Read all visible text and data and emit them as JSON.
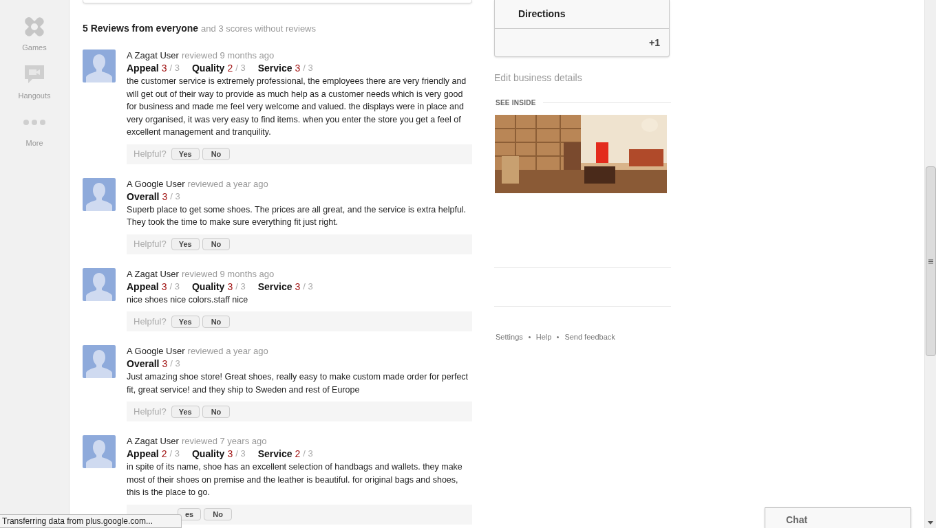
{
  "sidebar": {
    "items": [
      {
        "kind": "games",
        "label": "Games"
      },
      {
        "kind": "hangouts",
        "label": "Hangouts"
      },
      {
        "kind": "more",
        "label": "More"
      }
    ]
  },
  "reviews_header": {
    "title": "5 Reviews from everyone",
    "subtitle": "and 3 scores without reviews"
  },
  "reviews": [
    {
      "author": "A Zagat User",
      "when": "reviewed 9 months ago",
      "ratings": [
        {
          "label": "Appeal",
          "score": "3",
          "max": "/ 3"
        },
        {
          "label": "Quality",
          "score": "2",
          "max": "/ 3"
        },
        {
          "label": "Service",
          "score": "3",
          "max": "/ 3"
        }
      ],
      "text": "the customer service is extremely professional, the employees there are very friendly and will get out of their way to provide as much help as a customer needs which is very good for business and made me feel very welcome and valued. the displays were in place and very organised, it was very easy to find items. when you enter the store you get a feel of excellent management and tranquility.",
      "helpful": {
        "label": "Helpful?",
        "yes": "Yes",
        "no": "No"
      }
    },
    {
      "author": "A Google User",
      "when": "reviewed a year ago",
      "ratings": [
        {
          "label": "Overall",
          "score": "3",
          "max": "/ 3"
        }
      ],
      "text": "Superb place to get some shoes. The prices are all great, and the service is extra helpful. They took the time to make sure everything fit just right.",
      "helpful": {
        "label": "Helpful?",
        "yes": "Yes",
        "no": "No"
      }
    },
    {
      "author": "A Zagat User",
      "when": "reviewed 9 months ago",
      "ratings": [
        {
          "label": "Appeal",
          "score": "3",
          "max": "/ 3"
        },
        {
          "label": "Quality",
          "score": "3",
          "max": "/ 3"
        },
        {
          "label": "Service",
          "score": "3",
          "max": "/ 3"
        }
      ],
      "text": "nice shoes nice colors.staff nice",
      "helpful": {
        "label": "Helpful?",
        "yes": "Yes",
        "no": "No"
      }
    },
    {
      "author": "A Google User",
      "when": "reviewed a year ago",
      "ratings": [
        {
          "label": "Overall",
          "score": "3",
          "max": "/ 3"
        }
      ],
      "text": "Just amazing shoe store! Great shoes, really easy to make custom made order for perfect fit, great service! and they ship to Sweden and rest of Europe",
      "helpful": {
        "label": "Helpful?",
        "yes": "Yes",
        "no": "No"
      }
    },
    {
      "author": "A Zagat User",
      "when": "reviewed 7 years ago",
      "ratings": [
        {
          "label": "Appeal",
          "score": "2",
          "max": "/ 3"
        },
        {
          "label": "Quality",
          "score": "3",
          "max": "/ 3"
        },
        {
          "label": "Service",
          "score": "2",
          "max": "/ 3"
        }
      ],
      "text": "in spite of its name, shoe has an excellent selection of handbags and wallets. they make most of their shoes on premise and the leather is beautiful. for original bags and shoes, this is the place to go.",
      "helpful": {
        "yes": "es",
        "no": "No"
      }
    }
  ],
  "place_card": {
    "directions": "Directions",
    "plus_one": "+1"
  },
  "edit_link": "Edit business details",
  "see_inside": {
    "title": "SEE INSIDE"
  },
  "footer_links": [
    "Settings",
    "Help",
    "Send feedback"
  ],
  "status_bar": "Transferring data from plus.google.com...",
  "chat": {
    "label": "Chat"
  }
}
